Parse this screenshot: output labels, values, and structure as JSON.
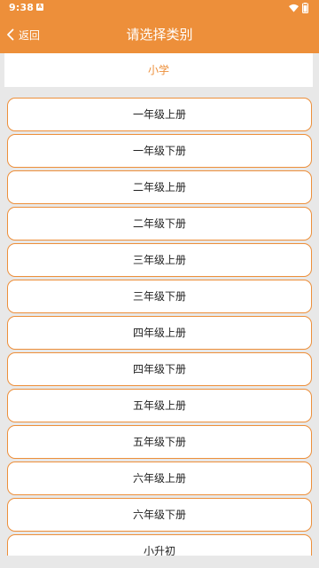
{
  "status": {
    "time": "9:38",
    "notification_badge": "A"
  },
  "header": {
    "back_label": "返回",
    "title": "请选择类别"
  },
  "category": {
    "label": "小学"
  },
  "items": [
    {
      "label": "一年级上册"
    },
    {
      "label": "一年级下册"
    },
    {
      "label": "二年级上册"
    },
    {
      "label": "二年级下册"
    },
    {
      "label": "三年级上册"
    },
    {
      "label": "三年级下册"
    },
    {
      "label": "四年级上册"
    },
    {
      "label": "四年级下册"
    },
    {
      "label": "五年级上册"
    },
    {
      "label": "五年级下册"
    },
    {
      "label": "六年级上册"
    },
    {
      "label": "六年级下册"
    },
    {
      "label": "小升初"
    }
  ],
  "colors": {
    "accent": "#ed8f3a",
    "background": "#e8e8e8",
    "surface": "#ffffff",
    "text": "#222222"
  }
}
